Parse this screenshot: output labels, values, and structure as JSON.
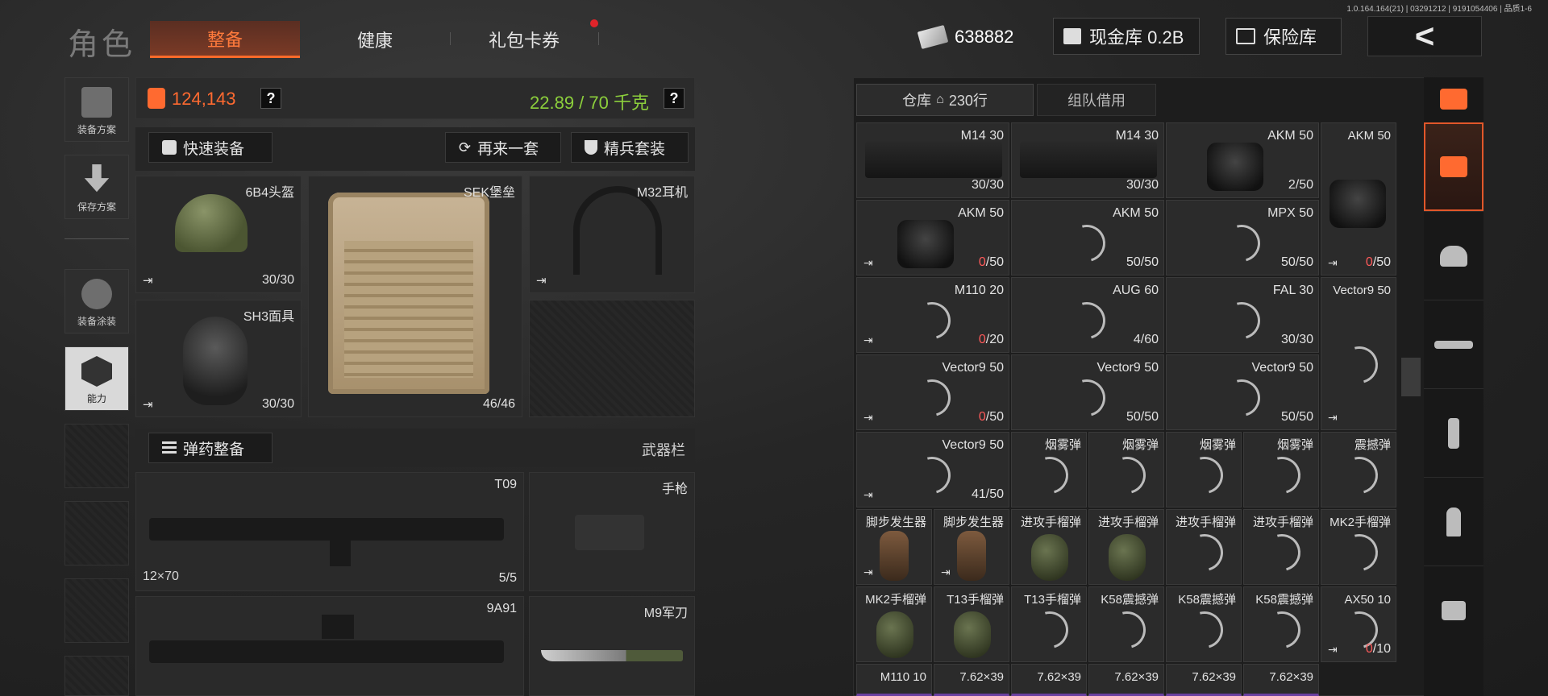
{
  "version": "1.0.164.164(21) | 03291212 | 9191054406 | 品质1-6",
  "header": {
    "title": "角色",
    "tabs": [
      {
        "label": "整备",
        "active": true
      },
      {
        "label": "健康",
        "active": false
      },
      {
        "label": "礼包卡券",
        "active": false,
        "badge": true
      }
    ],
    "money": "638882",
    "cash_vault": "现金库 0.2B",
    "insurance": "保险库",
    "back_icon": "<"
  },
  "sidebar": {
    "items": [
      {
        "label": "装备方案"
      },
      {
        "label": "保存方案"
      },
      {
        "label": "装备涂装"
      },
      {
        "label": "能力"
      }
    ]
  },
  "stats": {
    "value": "124,143",
    "weight": "22.89 / 70 千克",
    "q": "?"
  },
  "actions": {
    "quick_equip": "快速装备",
    "again": "再来一套",
    "elite": "精兵套装"
  },
  "gear": {
    "helmet": {
      "name": "6B4头盔",
      "durability": "30/30"
    },
    "mask": {
      "name": "SH3面具",
      "durability": "30/30"
    },
    "vest": {
      "name": "SEK堡垒",
      "durability": "46/46"
    },
    "headset": {
      "name": "M32耳机"
    }
  },
  "ammo_section": {
    "label": "弹药整备",
    "right_label": "武器栏"
  },
  "weapons": {
    "primary": {
      "name": "T09",
      "caliber": "12×70",
      "ammo": "5/5"
    },
    "pistol": {
      "name": "手枪"
    },
    "secondary": {
      "name": "9A91"
    },
    "knife": {
      "name": "M9军刀"
    }
  },
  "storage": {
    "tab_warehouse": "仓库",
    "rows": "230行",
    "tab_team": "组队借用"
  },
  "grid_items": [
    {
      "name": "M14 30",
      "count": "30/30"
    },
    {
      "name": "M14 30",
      "count": "30/30"
    },
    {
      "name": "AKM 50",
      "count": "2/50"
    },
    {
      "name": "AKM 50",
      "count_red": "0",
      "count_rest": "/50"
    },
    {
      "name": "AKM 50",
      "count_red": "0",
      "count_rest": "/50"
    },
    {
      "name": "AKM 50",
      "count": "50/50"
    },
    {
      "name": "MPX 50",
      "count": "50/50"
    },
    {
      "name": "M110 20",
      "count_red": "0",
      "count_rest": "/20"
    },
    {
      "name": "AUG 60",
      "count": "4/60"
    },
    {
      "name": "FAL 30",
      "count": "30/30"
    },
    {
      "name": "Vector9 50",
      "count": ""
    },
    {
      "name": "Vector9 50",
      "count_red": "0",
      "count_rest": "/50"
    },
    {
      "name": "Vector9 50",
      "count": "50/50"
    },
    {
      "name": "Vector9 50",
      "count": "50/50"
    },
    {
      "name": "Vector9 50",
      "count": "41/50"
    },
    {
      "name": "烟雾弹"
    },
    {
      "name": "烟雾弹"
    },
    {
      "name": "烟雾弹"
    },
    {
      "name": "烟雾弹"
    },
    {
      "name": "震撼弹"
    },
    {
      "name": "脚步发生器"
    },
    {
      "name": "脚步发生器"
    },
    {
      "name": "进攻手榴弹"
    },
    {
      "name": "进攻手榴弹"
    },
    {
      "name": "进攻手榴弹"
    },
    {
      "name": "进攻手榴弹"
    },
    {
      "name": "MK2手榴弹"
    },
    {
      "name": "MK2手榴弹"
    },
    {
      "name": "T13手榴弹"
    },
    {
      "name": "T13手榴弹"
    },
    {
      "name": "K58震撼弹"
    },
    {
      "name": "K58震撼弹"
    },
    {
      "name": "K58震撼弹"
    },
    {
      "name": "AX50 10",
      "count_red": "0",
      "count_rest": "/10"
    },
    {
      "name": "M110 10"
    },
    {
      "name": "7.62×39"
    },
    {
      "name": "7.62×39"
    },
    {
      "name": "7.62×39"
    },
    {
      "name": "7.62×39"
    },
    {
      "name": "7.62×39"
    }
  ]
}
